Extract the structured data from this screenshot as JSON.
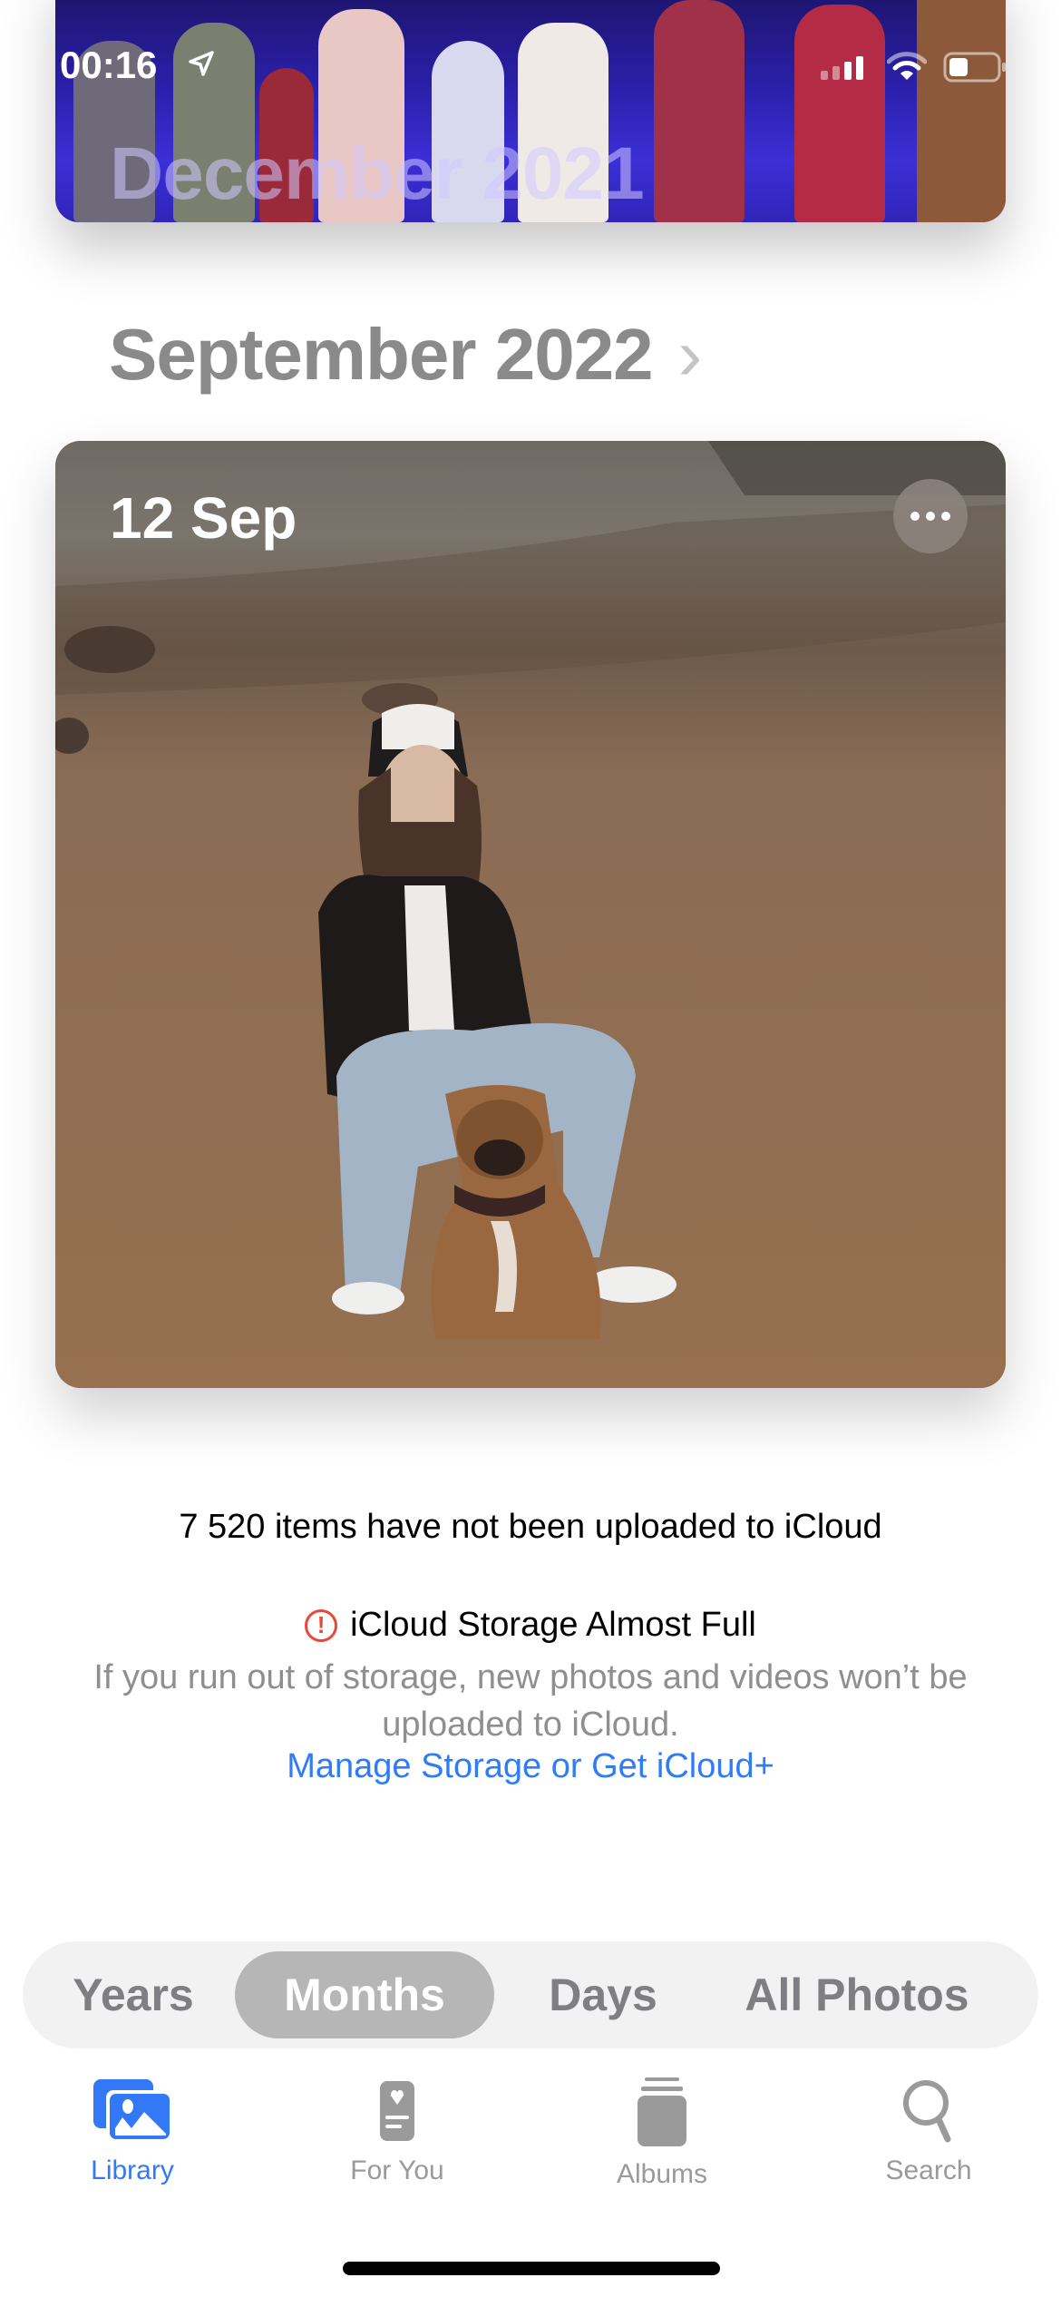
{
  "status_bar": {
    "time": "00:16",
    "location_icon": "location-arrow-icon",
    "signal_icon": "cellular-signal-icon",
    "wifi_icon": "wifi-icon",
    "battery_icon": "battery-icon"
  },
  "previous_month": {
    "label": "December 2021"
  },
  "current_month": {
    "title": "September 2022",
    "chevron_icon": "chevron-right-icon",
    "day_label": "12 Sep",
    "more_icon": "ellipsis-icon"
  },
  "icloud": {
    "upload_status": "7 520 items have not been uploaded to iCloud",
    "alert_icon_glyph": "!",
    "storage_title": "iCloud Storage Almost Full",
    "storage_body": "If you run out of storage, new photos and videos won’t be uploaded to iCloud.",
    "manage_link": "Manage Storage or Get iCloud+",
    "link_color": "#2f7cf6",
    "alert_color": "#e5493a"
  },
  "segments": {
    "items": [
      {
        "label": "Years",
        "active": false
      },
      {
        "label": "Months",
        "active": true
      },
      {
        "label": "Days",
        "active": false
      },
      {
        "label": "All Photos",
        "active": false
      }
    ]
  },
  "tabbar": {
    "accent": "#3378f6",
    "items": [
      {
        "label": "Library",
        "icon": "photo-library-icon",
        "active": true
      },
      {
        "label": "For You",
        "icon": "for-you-icon",
        "active": false
      },
      {
        "label": "Albums",
        "icon": "albums-icon",
        "active": false
      },
      {
        "label": "Search",
        "icon": "search-icon",
        "active": false
      }
    ]
  }
}
